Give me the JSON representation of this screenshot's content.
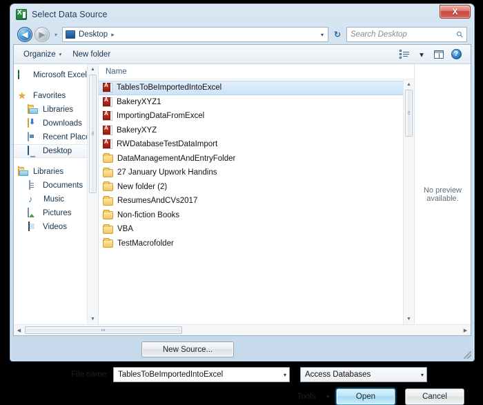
{
  "window": {
    "title": "Select Data Source",
    "app_icon": "excel-icon",
    "close_label": "X"
  },
  "address_bar": {
    "back_icon": "back-arrow-icon",
    "forward_icon": "forward-arrow-icon",
    "history_caret": "▾",
    "path_label": "Desktop",
    "path_separator": "▸",
    "dropdown_caret": "▾",
    "refresh_icon": "↻",
    "search_placeholder": "Search Desktop",
    "search_icon": "search-icon"
  },
  "toolbar": {
    "organize_label": "Organize",
    "organize_caret": "▾",
    "new_folder_label": "New folder",
    "views_caret": "▾",
    "views_icon": "view-layout-icon",
    "preview_pane_icon": "preview-pane-icon",
    "help_label": "?"
  },
  "sidebar": {
    "items": [
      {
        "label": "Microsoft Excel",
        "icon": "excel-icon",
        "indent": false,
        "selected": false
      },
      {
        "label": "Favorites",
        "icon": "star-icon",
        "indent": false,
        "selected": false
      },
      {
        "label": "Libraries",
        "icon": "library-folder-icon",
        "indent": true,
        "selected": false
      },
      {
        "label": "Downloads",
        "icon": "downloads-icon",
        "indent": true,
        "selected": false
      },
      {
        "label": "Recent Places",
        "icon": "recent-places-icon",
        "indent": true,
        "selected": false
      },
      {
        "label": "Desktop",
        "icon": "desktop-icon",
        "indent": true,
        "selected": true
      },
      {
        "label": "Libraries",
        "icon": "library-folder-icon",
        "indent": false,
        "selected": false
      },
      {
        "label": "Documents",
        "icon": "document-icon",
        "indent": true,
        "selected": false
      },
      {
        "label": "Music",
        "icon": "music-note-icon",
        "indent": true,
        "selected": false
      },
      {
        "label": "Pictures",
        "icon": "picture-icon",
        "indent": true,
        "selected": false
      },
      {
        "label": "Videos",
        "icon": "video-icon",
        "indent": true,
        "selected": false
      }
    ]
  },
  "file_list": {
    "column_header": "Name",
    "rows": [
      {
        "name": "TablesToBeImportedIntoExcel",
        "type": "access-file",
        "selected": true
      },
      {
        "name": "BakeryXYZ1",
        "type": "access-file",
        "selected": false
      },
      {
        "name": "ImportingDataFromExcel",
        "type": "access-file",
        "selected": false
      },
      {
        "name": "BakeryXYZ",
        "type": "access-file",
        "selected": false
      },
      {
        "name": "RWDatabaseTestDataImport",
        "type": "access-file",
        "selected": false
      },
      {
        "name": "DataManagementAndEntryFolder",
        "type": "folder",
        "selected": false
      },
      {
        "name": "27 January Upwork Handins",
        "type": "folder",
        "selected": false
      },
      {
        "name": "New folder (2)",
        "type": "folder",
        "selected": false
      },
      {
        "name": "ResumesAndCVs2017",
        "type": "folder",
        "selected": false
      },
      {
        "name": "Non-fiction Books",
        "type": "folder",
        "selected": false
      },
      {
        "name": "VBA",
        "type": "folder",
        "selected": false
      },
      {
        "name": "TestMacrofolder",
        "type": "folder",
        "selected": false
      }
    ]
  },
  "preview_pane": {
    "message": "No preview available."
  },
  "footer": {
    "new_source_label": "New Source...",
    "file_name_label": "File name:",
    "file_name_value": "TablesToBeImportedIntoExcel",
    "file_name_caret": "▾",
    "filter_value": "Access Databases",
    "filter_caret": "▾",
    "tools_label": "Tools",
    "tools_caret": "▾",
    "open_label": "Open",
    "cancel_label": "Cancel"
  },
  "colors": {
    "accent": "#3d9bc9",
    "selection": "#cfe3f8",
    "access_red": "#9b1b12",
    "excel_green": "#1d7a3a"
  }
}
